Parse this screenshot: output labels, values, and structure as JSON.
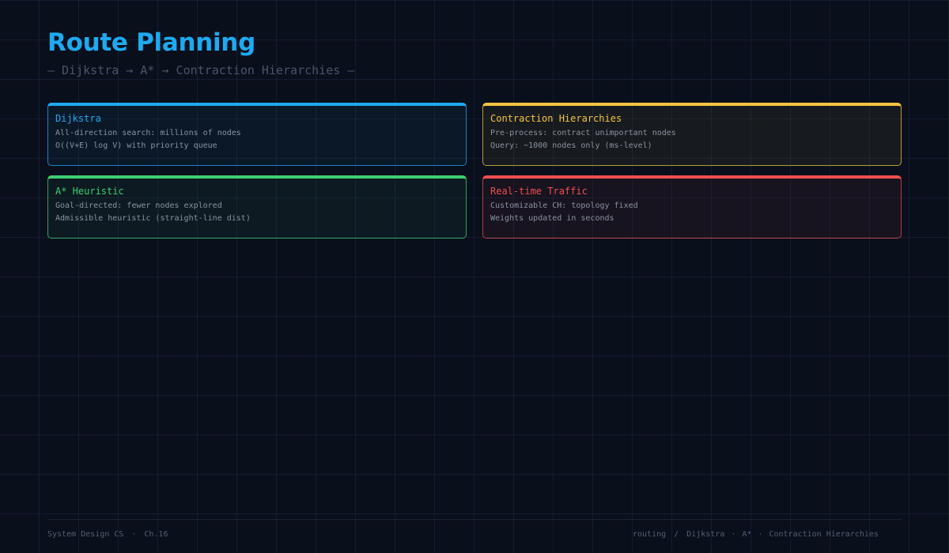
{
  "header": {
    "title": "Route Planning",
    "subtitle": "— Dijkstra → A* → Contraction Hierarchies —"
  },
  "cards": [
    {
      "title": "Dijkstra",
      "lines": [
        "All-direction search: millions of nodes",
        "O((V+E) log V) with priority queue"
      ],
      "accent": "#1eaaf0"
    },
    {
      "title": "Contraction Hierarchies",
      "lines": [
        "Pre-process: contract unimportant nodes",
        "Query: ~1000 nodes only (ms-level)"
      ],
      "accent": "#f5c542"
    },
    {
      "title": "A* Heuristic",
      "lines": [
        "Goal-directed: fewer nodes explored",
        "Admissible heuristic (straight-line dist)"
      ],
      "accent": "#3ecf72"
    },
    {
      "title": "Real-time Traffic",
      "lines": [
        "Customizable CH: topology fixed",
        "Weights updated in seconds"
      ],
      "accent": "#ef4f4f"
    }
  ],
  "footer": {
    "series": "System Design CS",
    "separator": "·",
    "chapter": "Ch.16",
    "topic": "routing",
    "slash": "/",
    "breadcrumb_1": "Dijkstra",
    "breadcrumb_2": "A*",
    "breadcrumb_3": "Contraction Hierarchies"
  },
  "colors": {
    "background": "#0a0f1c",
    "title": "#1eaaf0",
    "muted_text": "#8a93a3"
  }
}
